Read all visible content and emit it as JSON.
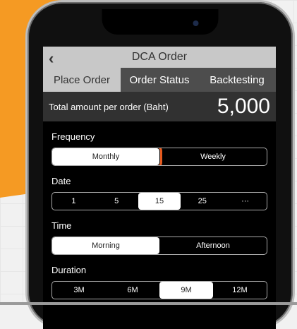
{
  "header": {
    "title": "DCA Order"
  },
  "tabs": [
    {
      "label": "Place Order"
    },
    {
      "label": "Order Status"
    },
    {
      "label": "Backtesting"
    }
  ],
  "amount": {
    "label": "Total amount per order (Baht)",
    "value": "5,000"
  },
  "frequency": {
    "title": "Frequency",
    "options": [
      "Monthly",
      "Weekly"
    ],
    "selected": "Monthly"
  },
  "date": {
    "title": "Date",
    "options": [
      "1",
      "5",
      "15",
      "25",
      "···"
    ],
    "selected": "15"
  },
  "time": {
    "title": "Time",
    "options": [
      "Morning",
      "Afternoon"
    ],
    "selected": "Morning"
  },
  "duration": {
    "title": "Duration",
    "options": [
      "3M",
      "6M",
      "9M",
      "12M"
    ],
    "selected": "9M"
  },
  "colors": {
    "accent": "#e55a1f",
    "background": "#000000",
    "highlight": "#f59a23"
  },
  "icons": {
    "back": "chevron-left-icon"
  }
}
